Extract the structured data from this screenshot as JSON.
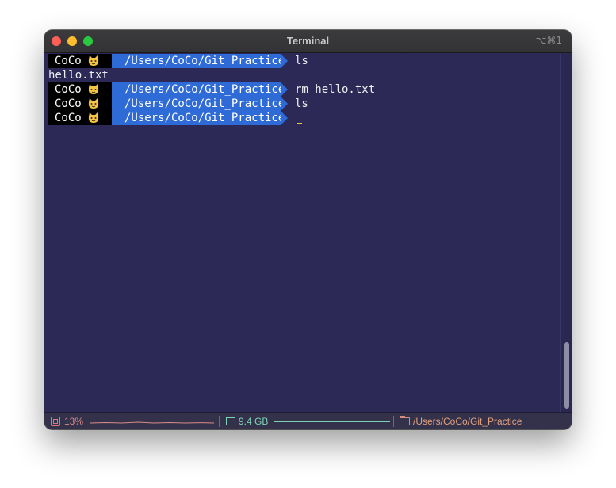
{
  "window": {
    "title": "Terminal",
    "shortcut": "⌥⌘1"
  },
  "prompt": {
    "user": "CoCo",
    "emoji": "cat-face",
    "path": "/Users/CoCo/Git_Practice"
  },
  "lines": [
    {
      "type": "prompt",
      "user": "CoCo",
      "path": "/Users/CoCo/Git_Practice",
      "command": "ls"
    },
    {
      "type": "output",
      "text": "hello.txt"
    },
    {
      "type": "prompt",
      "user": "CoCo",
      "path": "/Users/CoCo/Git_Practice",
      "command": "rm hello.txt"
    },
    {
      "type": "prompt",
      "user": "CoCo",
      "path": "/Users/CoCo/Git_Practice",
      "command": "ls"
    },
    {
      "type": "prompt",
      "user": "CoCo",
      "path": "/Users/CoCo/Git_Practice",
      "command": ""
    }
  ],
  "status": {
    "cpu": "13%",
    "memory": "9.4 GB",
    "cwd": "/Users/CoCo/Git_Practice"
  },
  "colors": {
    "background": "#2c2956",
    "prompt_user_bg": "#000000",
    "prompt_path_bg": "#2f6bd6",
    "cursor": "#f5c542"
  }
}
